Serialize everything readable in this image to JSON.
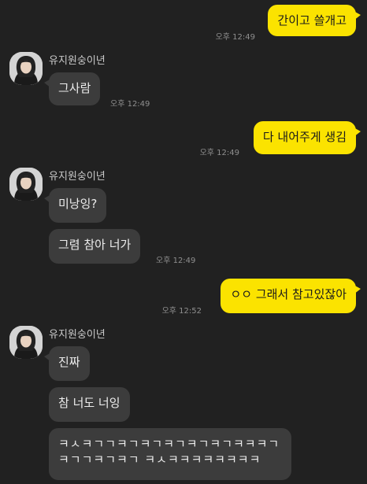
{
  "sender_name": "유지원숭이년",
  "messages": [
    {
      "text": "간이고 쓸개고",
      "time": "오후 12:49"
    },
    {
      "text": "그사람",
      "time": "오후 12:49"
    },
    {
      "text": "다 내어주게 생김",
      "time": "오후 12:49"
    },
    {
      "text": "미낭잉?"
    },
    {
      "text": "그렴 참아 너가",
      "time": "오후 12:49"
    },
    {
      "text": "ㅇㅇ 그래서 참고있잖아",
      "time": "오후 12:52"
    },
    {
      "text": "진짜"
    },
    {
      "text": "참 너도 너잉"
    },
    {
      "text": "ㅋㅅㅋㄱㄱㅋㄱㅋㄱㅋㄱㅋㄱㅋㄱㅋㅋㅋㄱㅋㄱㄱㅋㄱㅋㄱ ㅋㅅㅋㅋㅋㅋㅋㅋㅋㅋ"
    }
  ],
  "colors": {
    "background": "#212121",
    "my_bubble": "#fbe300",
    "other_bubble": "#3c3c3c"
  },
  "icons": {
    "avatar": "profile-photo"
  }
}
